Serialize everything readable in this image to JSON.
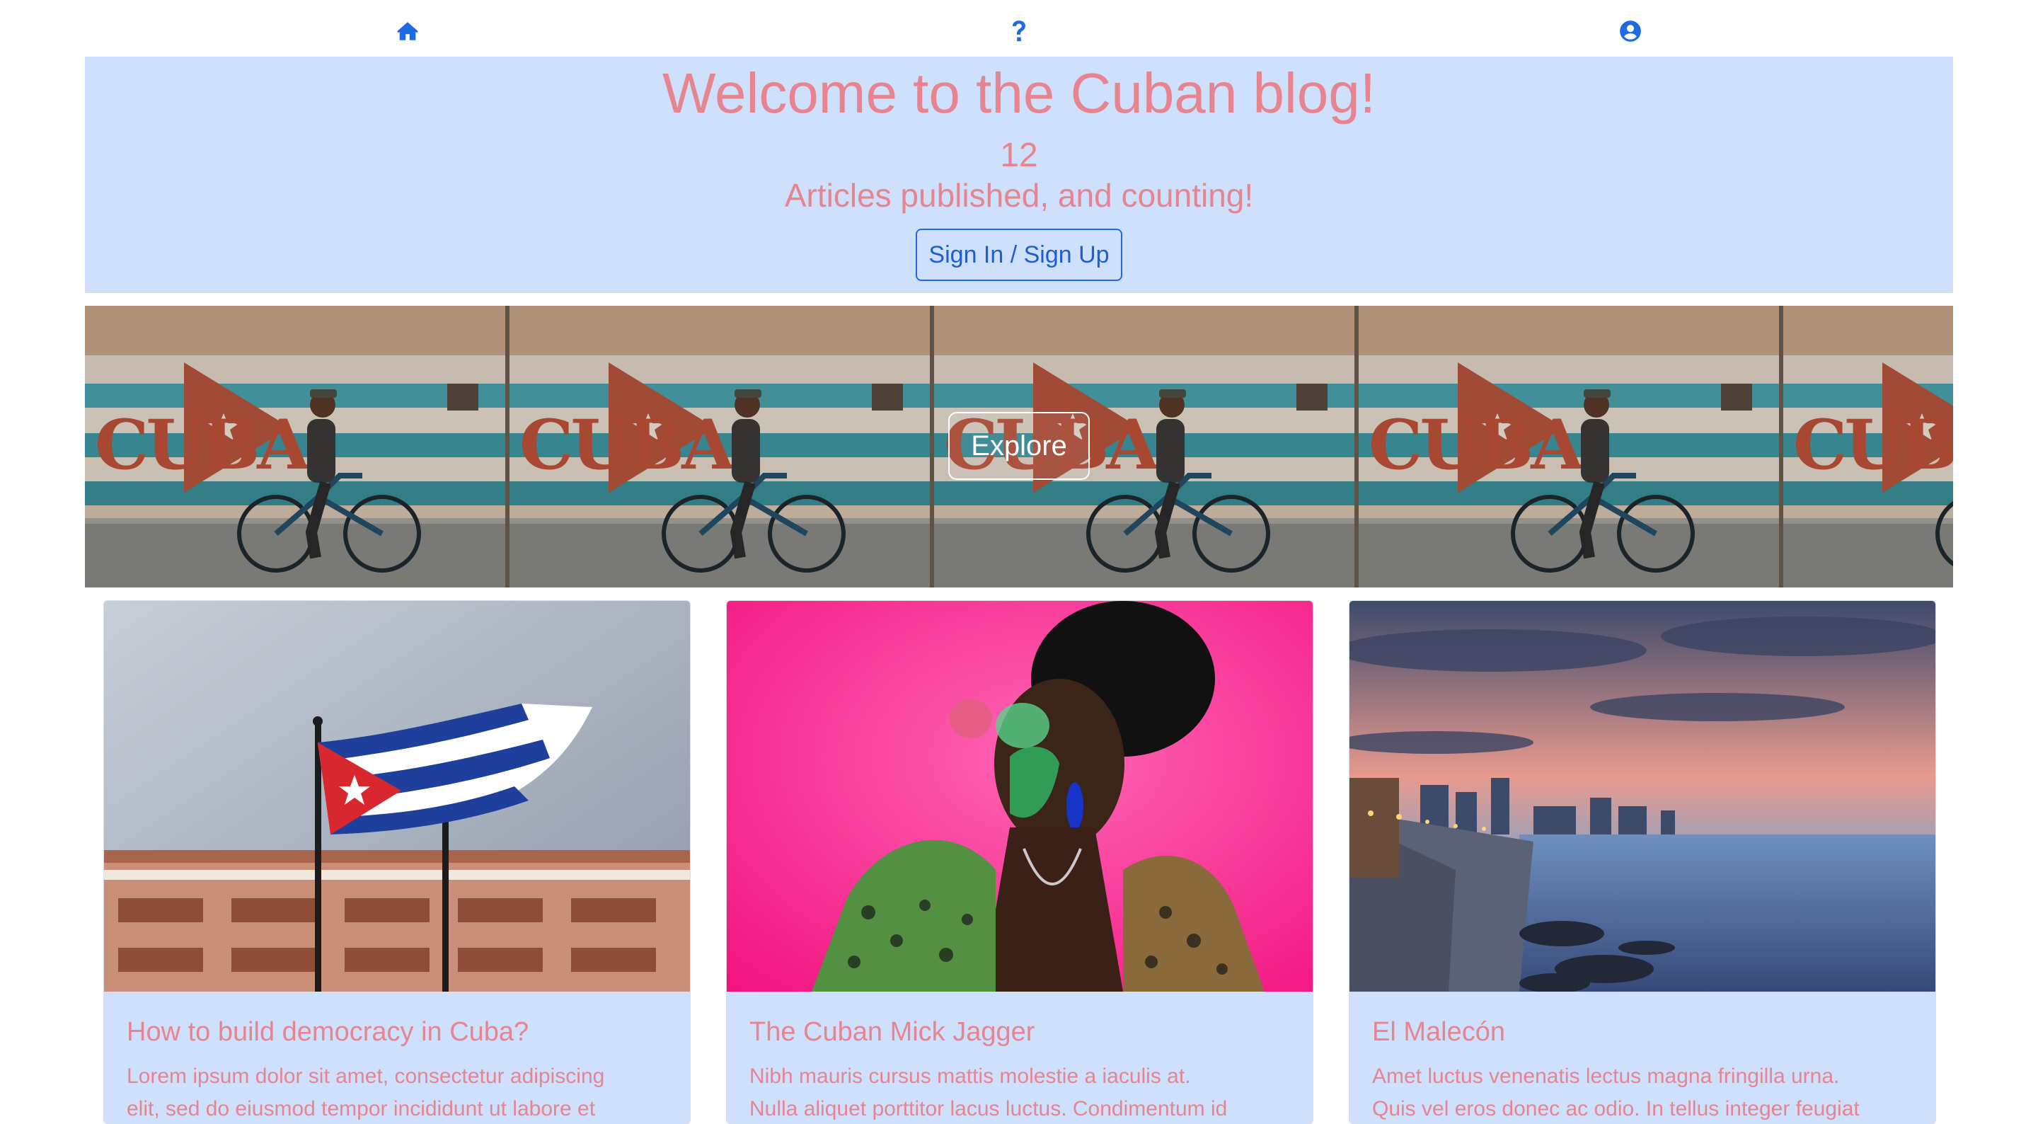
{
  "nav": {
    "icons": [
      "home-icon",
      "question-icon",
      "user-circle-icon"
    ]
  },
  "colors": {
    "accent": "#1d6ae5",
    "hero_bg": "#cfe0fc",
    "hero_text": "#e6858f"
  },
  "hero": {
    "title": "Welcome to the Cuban blog!",
    "count": "12",
    "subtitle": "Articles published, and counting!",
    "signin_label": "Sign In / Sign Up"
  },
  "banner": {
    "explore_label": "Explore",
    "wall_text": "CUBA"
  },
  "cards": [
    {
      "title": "How to build democracy in Cuba?",
      "line1": "Lorem ipsum dolor sit amet, consectetur adipiscing",
      "line2": "elit, sed do eiusmod tempor incididunt ut labore et"
    },
    {
      "title": "The Cuban Mick Jagger",
      "line1": "Nibh mauris cursus mattis molestie a iaculis at.",
      "line2": "Nulla aliquet porttitor lacus luctus. Condimentum id"
    },
    {
      "title": "El Malecón",
      "line1": "Amet luctus venenatis lectus magna fringilla urna.",
      "line2": "Quis vel eros donec ac odio. In tellus integer feugiat"
    }
  ]
}
